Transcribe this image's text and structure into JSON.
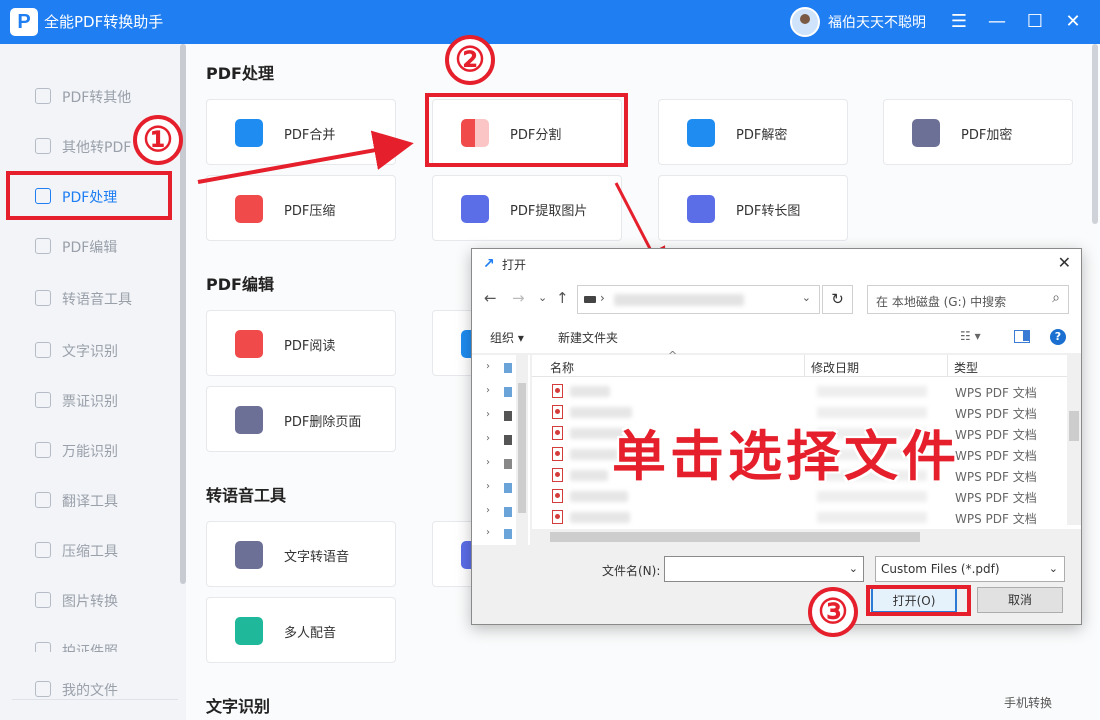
{
  "app": {
    "title": "全能PDF转换助手",
    "logo": "P",
    "username": "福伯天天不聪明",
    "menu_icon": "☰",
    "min_icon": "—",
    "max_icon": "☐",
    "close_icon": "✕"
  },
  "sidebar": {
    "items": [
      {
        "label": "PDF转其他"
      },
      {
        "label": "其他转PDF"
      },
      {
        "label": "PDF处理"
      },
      {
        "label": "PDF编辑"
      },
      {
        "label": "转语音工具"
      },
      {
        "label": "文字识别"
      },
      {
        "label": "票证识别"
      },
      {
        "label": "万能识别"
      },
      {
        "label": "翻译工具"
      },
      {
        "label": "压缩工具"
      },
      {
        "label": "图片转换"
      },
      {
        "label": "拍证件照"
      },
      {
        "label": "我的文件"
      }
    ]
  },
  "sections": {
    "pdf_process": {
      "title": "PDF处理",
      "cards": [
        "PDF合并",
        "PDF分割",
        "PDF解密",
        "PDF加密",
        "PDF压缩",
        "PDF提取图片",
        "PDF转长图"
      ]
    },
    "pdf_edit": {
      "title": "PDF编辑",
      "cards": [
        "PDF阅读",
        "PDF删除页面"
      ]
    },
    "tts": {
      "title": "转语音工具",
      "cards": [
        "文字转语音",
        "多人配音"
      ]
    },
    "ocr": {
      "title": "文字识别"
    }
  },
  "annotations": {
    "step1": "①",
    "step2": "②",
    "step3": "③",
    "overlay_text": "单击选择文件"
  },
  "dialog": {
    "title": "打开",
    "title_icon": "↗",
    "close": "✕",
    "nav": {
      "back": "←",
      "forward": "→",
      "recent": "⌄",
      "up": "↑",
      "refresh": "↻",
      "addr_chevron": "⌄",
      "addr_sep": "›"
    },
    "search_placeholder": "在 本地磁盘 (G:) 中搜索",
    "search_icon": "⌕",
    "toolbar": {
      "organize": "组织 ▾",
      "new_folder": "新建文件夹",
      "view": "☷ ▾",
      "help": "?"
    },
    "columns": {
      "name": "名称",
      "date": "修改日期",
      "type": "类型",
      "sort_indicator": "^"
    },
    "file_type": "WPS PDF 文档",
    "filename_label": "文件名(N):",
    "filter": "Custom Files (*.pdf)",
    "chevron": "⌄",
    "open": "打开(O)",
    "cancel": "取消"
  },
  "footer": {
    "mobile_convert": "手机转换"
  },
  "colors": {
    "brand": "#1e7ef2",
    "annotation": "#e5202c"
  }
}
